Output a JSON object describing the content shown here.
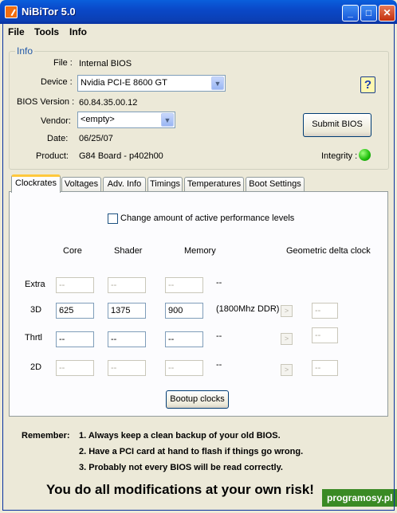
{
  "window": {
    "title": "NiBiTor 5.0",
    "minimize": "_",
    "maximize": "□",
    "close": "✕"
  },
  "menu": {
    "file": "File",
    "tools": "Tools",
    "info": "Info"
  },
  "info": {
    "legend": "Info",
    "file_label": "File :",
    "file_value": "Internal BIOS",
    "device_label": "Device :",
    "device_value": "Nvidia PCI-E 8600 GT",
    "bios_version_label": "BIOS Version :",
    "bios_version_value": "60.84.35.00.12",
    "vendor_label": "Vendor:",
    "vendor_value": "<empty>",
    "date_label": "Date:",
    "date_value": "06/25/07",
    "product_label": "Product:",
    "product_value": "G84 Board - p402h00",
    "help_icon": "?",
    "submit_label": "Submit BIOS",
    "integrity_label": "Integrity :",
    "integrity_color": "#1dbd0a"
  },
  "tabs": [
    "Clockrates",
    "Voltages",
    "Adv. Info",
    "Timings",
    "Temperatures",
    "Boot Settings"
  ],
  "clockrates": {
    "checkbox_label": "Change amount of active performance levels",
    "headers": {
      "core": "Core",
      "shader": "Shader",
      "memory": "Memory",
      "geometric": "Geometric delta clock"
    },
    "rows": [
      {
        "label": "Extra",
        "core": "--",
        "shader": "--",
        "memory": "--",
        "note": "--"
      },
      {
        "label": "3D",
        "core": "625",
        "shader": "1375",
        "memory": "900",
        "note": "(1800Mhz DDR)",
        "arrow": ">",
        "geo": "--"
      },
      {
        "label": "Thrtl",
        "core": "--",
        "shader": "--",
        "memory": "--",
        "note": "--",
        "arrow": ">",
        "geo": "--"
      },
      {
        "label": "2D",
        "core": "--",
        "shader": "--",
        "memory": "--",
        "note": "--",
        "arrow": ">",
        "geo": "--"
      }
    ],
    "bootup_label": "Bootup clocks"
  },
  "remember": {
    "label": "Remember:",
    "lines": [
      "1. Always keep a clean backup of your old BIOS.",
      "2. Have a PCI card at hand to flash if things go wrong.",
      "3. Probably not every BIOS will be read correctly."
    ]
  },
  "warning": "You do all modifications at your own risk!",
  "watermark": "programosy.pl"
}
